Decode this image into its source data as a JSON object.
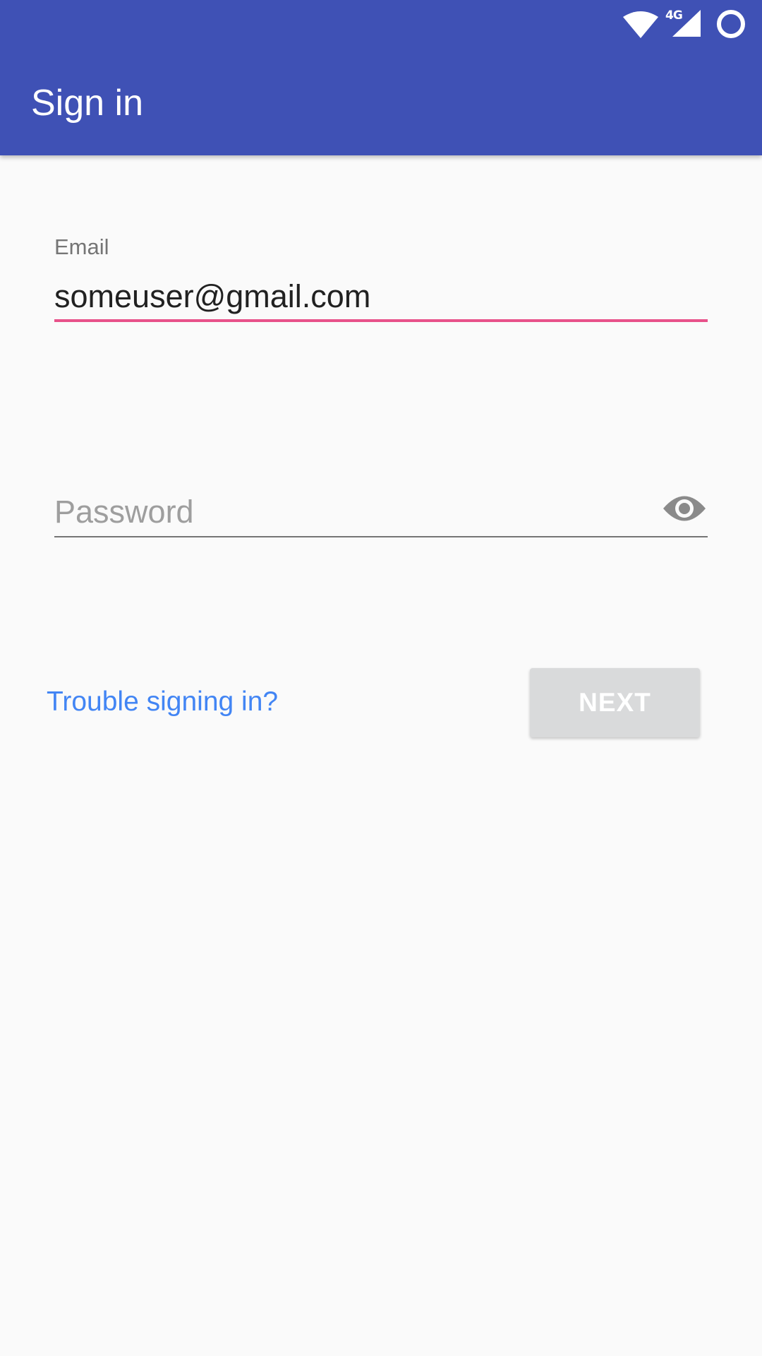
{
  "status_bar": {
    "network_type": "4G",
    "icons": [
      "wifi-icon",
      "cell-signal-icon",
      "battery-icon"
    ]
  },
  "app_bar": {
    "title": "Sign in",
    "color": "#3f51b5"
  },
  "form": {
    "email": {
      "label": "Email",
      "value": "someuser@gmail.com",
      "underline_color": "#e8528a"
    },
    "password": {
      "placeholder": "Password",
      "value": "",
      "toggle_icon": "eye-icon"
    },
    "trouble_link": "Trouble signing in?",
    "next_label": "NEXT"
  },
  "colors": {
    "link": "#4285f4",
    "button_disabled": "#d9dadb",
    "background": "#fafafa"
  }
}
